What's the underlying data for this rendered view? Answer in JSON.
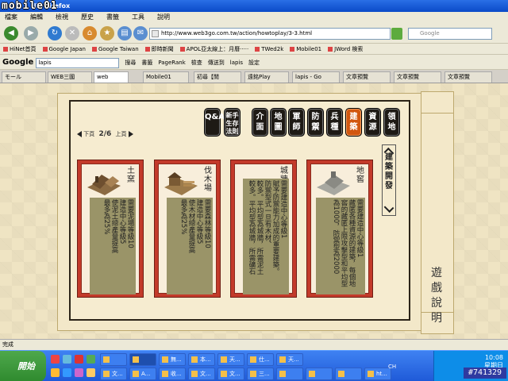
{
  "window": {
    "title": "illa Firefox"
  },
  "watermark": "mobile01",
  "menu": [
    "檔案",
    "編輯",
    "檢視",
    "歷史",
    "書籤",
    "工具",
    "說明"
  ],
  "nav": {
    "url": "http://www.web3go.com.tw/action/howtoplay/3-3.html",
    "search_placeholder": "Google"
  },
  "bookmarks": [
    "HiNet首頁",
    "Google Japan",
    "Google Taiwan",
    "即時新聞",
    "APOL亞太線上：月曆·····",
    "TWed2k",
    "Mobile01",
    "JWord 検索"
  ],
  "googlebar": {
    "logo": "Google",
    "query": "lapis",
    "items": [
      "搜尋",
      "書籤",
      "PageRank",
      "檢查",
      "傳送到",
      "lapis",
      "設定"
    ]
  },
  "tabs": [
    "モール",
    "WEB三國",
    "web",
    "Mobile01",
    "初尋【閒",
    "遠銘Play",
    "lapis - Go",
    "文章預覽",
    "文章預覽",
    "文章預覽"
  ],
  "game": {
    "scroll_title": "遊戲說明",
    "categories": [
      {
        "label": "Q&A",
        "active": false
      },
      {
        "label": "新手生存法則",
        "active": false
      },
      {
        "label": "介面",
        "active": false
      },
      {
        "label": "地圖",
        "active": false
      },
      {
        "label": "軍師",
        "active": false
      },
      {
        "label": "防禦",
        "active": false
      },
      {
        "label": "兵種",
        "active": false
      },
      {
        "label": "建築",
        "active": true
      },
      {
        "label": "資源",
        "active": false
      },
      {
        "label": "領地",
        "active": false
      }
    ],
    "pager": {
      "prev": "下頁",
      "page": "2/6",
      "next": "上頁"
    },
    "section_tab": "建築開發",
    "cards": [
      {
        "name": "土窯",
        "lines": [
          "需要泥場等級10",
          "建造中心等級5",
          "使泥土總產量提高",
          "最多為25%"
        ]
      },
      {
        "name": "伐木場",
        "lines": [
          "需要森林等級10",
          "建造中心等級5",
          "使木材總產量提高",
          "最多為25%"
        ]
      },
      {
        "name": "城牆",
        "lines": [
          "需要建造中心等級1",
          "賦予防禦能力加成的重要建築。",
          "防禦型式一旦有木材、",
          "較多。平均型為城牆，所需泥土",
          "較多。平均型為城牆，所需礦石"
        ]
      },
      {
        "name": "地窖",
        "lines": [
          "需要建造中心等級1",
          "藏匿各種資源的建築，每個地",
          "窖的藏匿上限攻擊型和平均型",
          "為1000，防禦型為2000"
        ]
      }
    ]
  },
  "status": "完成",
  "taskbar": {
    "start_label": "開始",
    "buttons": [
      "無...",
      "本...",
      "天...",
      "仕...",
      "天...",
      "文...",
      "收...",
      "文...",
      "文...",
      "三...",
      "A...",
      "ht..."
    ],
    "clock_time": "10:08",
    "clock_day": "星期日",
    "ime": "CH"
  },
  "id_tag": "#741329"
}
